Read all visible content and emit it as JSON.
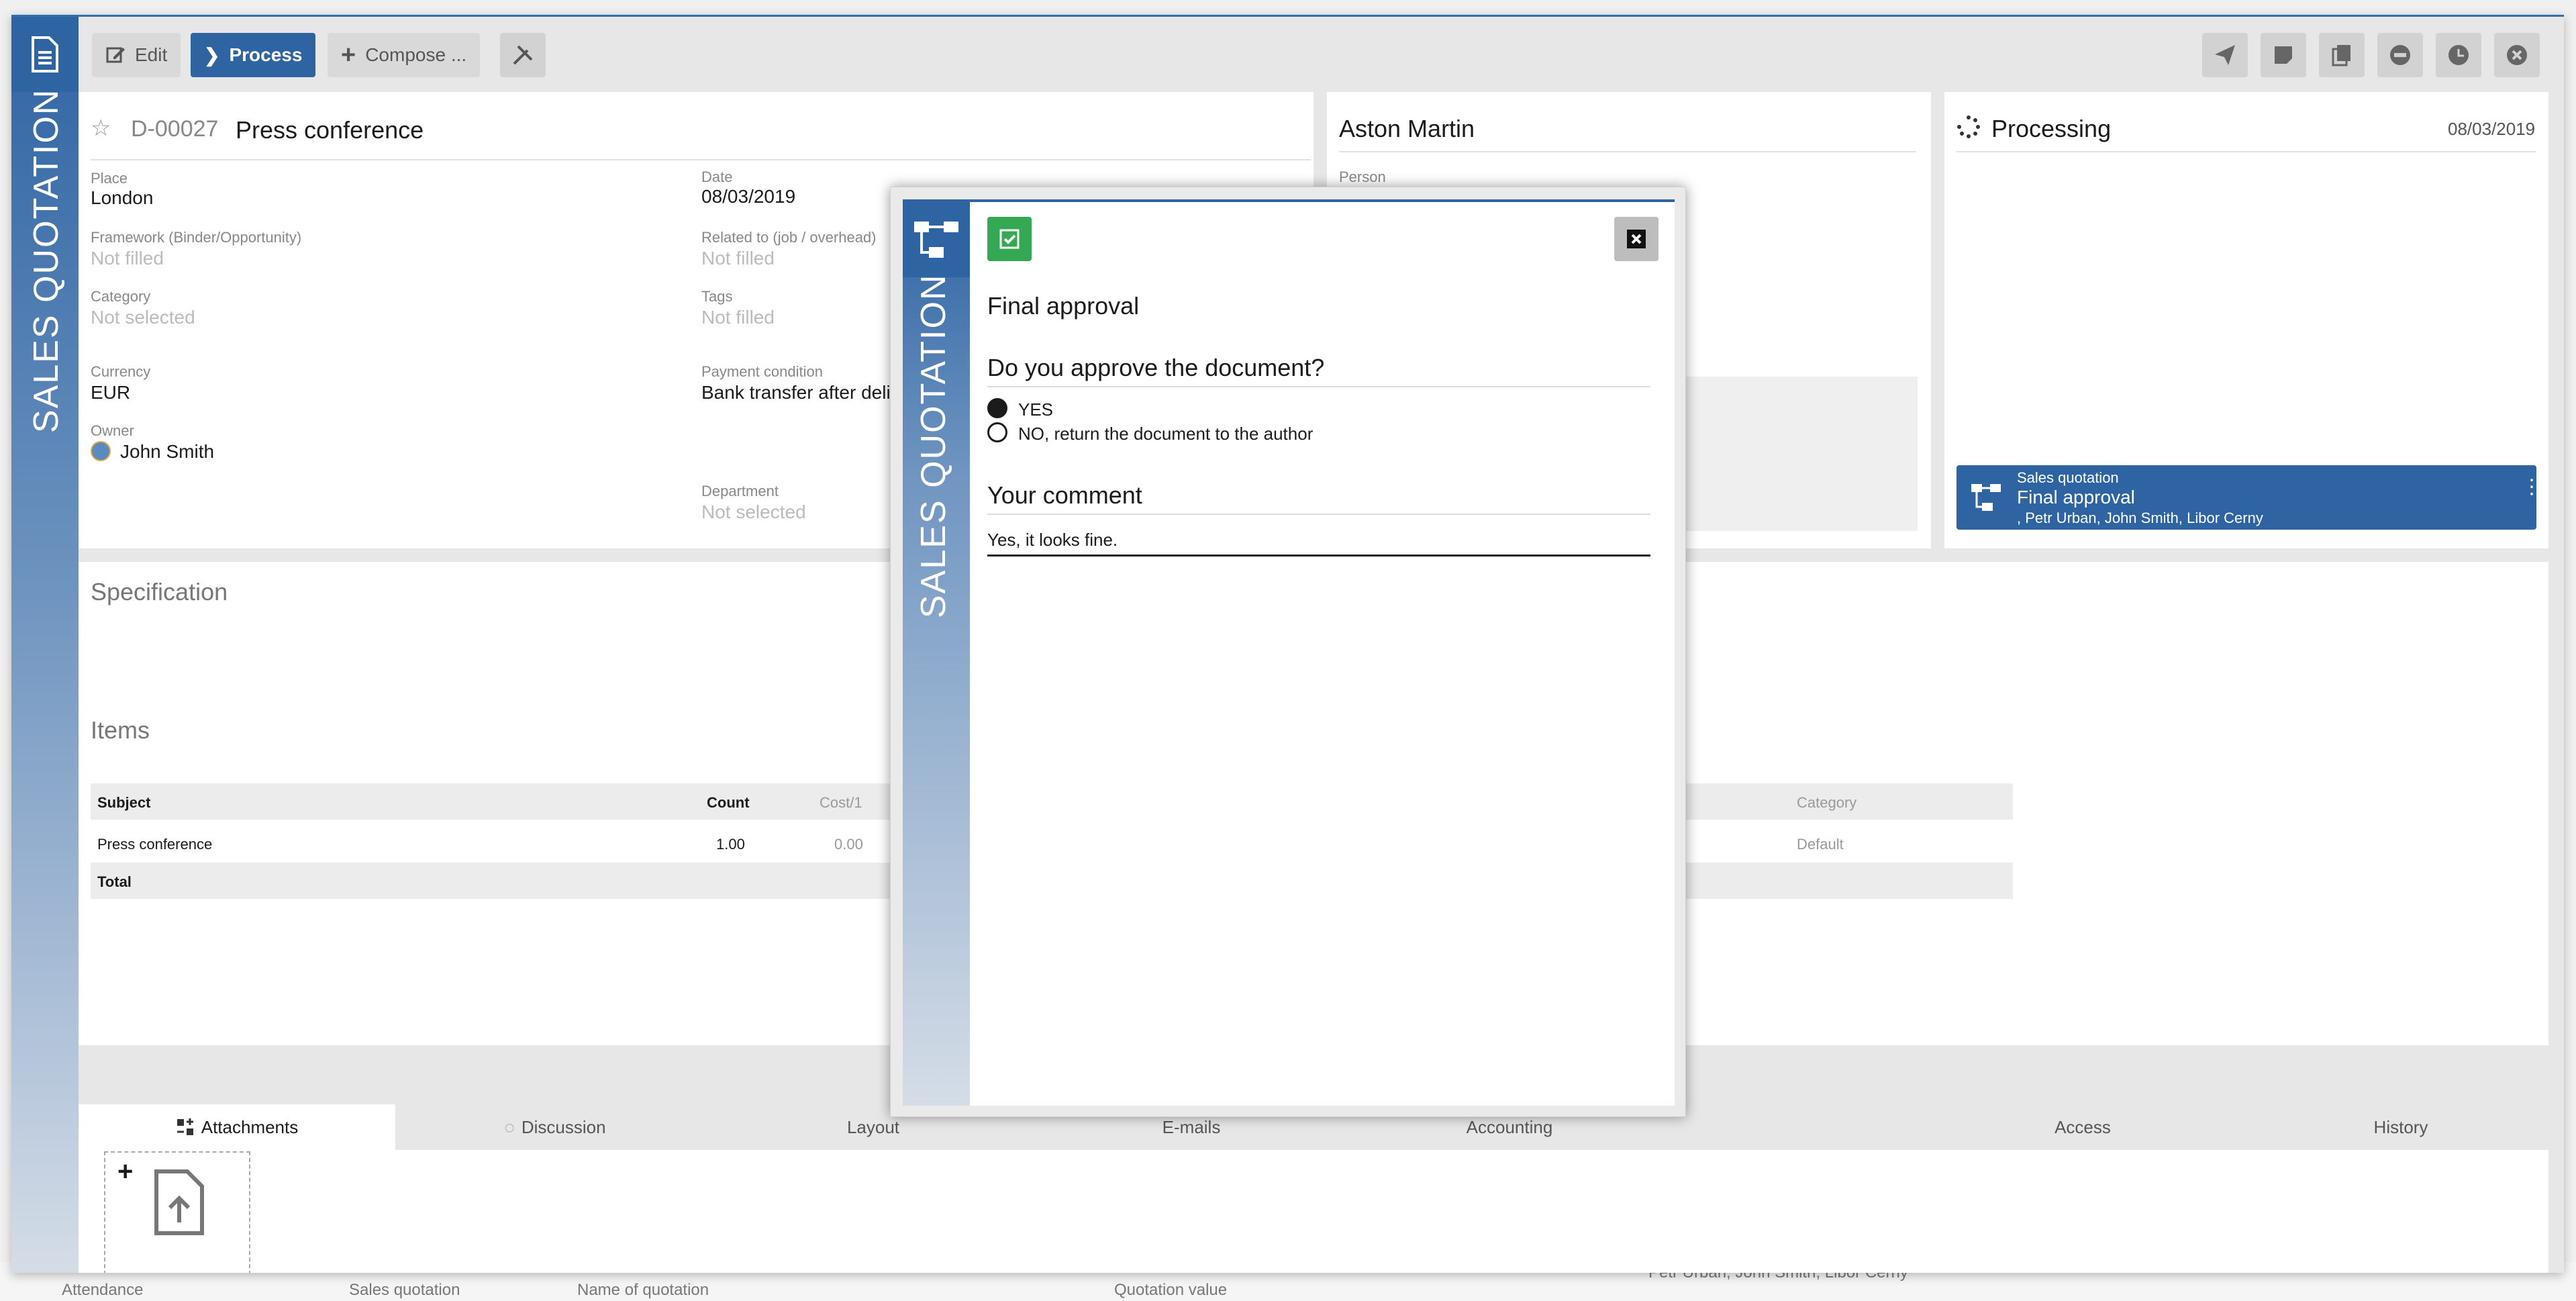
{
  "background": {
    "bottom_items": [
      "Attendance",
      "Sales quotation",
      "Name of quotation",
      "Quotation value",
      "Petr Urban, John Smith, Libor Cerny"
    ]
  },
  "toolbar": {
    "edit_label": "Edit",
    "process_label": "Process",
    "compose_label": "Compose ..."
  },
  "app": {
    "rail_title": "SALES QUOTATION"
  },
  "document": {
    "number": "D-00027",
    "title": "Press conference",
    "fields": {
      "place_label": "Place",
      "place_value": "London",
      "date_label": "Date",
      "date_value": "08/03/2019",
      "framework_label": "Framework (Binder/Opportunity)",
      "framework_value": "Not filled",
      "related_label": "Related to (job / overhead)",
      "related_value": "Not filled",
      "category_label": "Category",
      "category_value": "Not selected",
      "tags_label": "Tags",
      "tags_value": "Not filled",
      "currency_label": "Currency",
      "currency_value": "EUR",
      "payment_label": "Payment condition",
      "payment_value": "Bank transfer after deli",
      "owner_label": "Owner",
      "owner_value": "John Smith",
      "department_label": "Department",
      "department_value": "Not selected"
    }
  },
  "partner": {
    "name": "Aston Martin",
    "person_label": "Person"
  },
  "status": {
    "label": "Processing",
    "date": "08/03/2019",
    "workflow": {
      "kind": "Sales quotation",
      "step": "Final approval",
      "people": ", Petr Urban, John Smith, Libor Cerny"
    }
  },
  "specification": {
    "title": "Specification"
  },
  "items": {
    "title": "Items",
    "columns": {
      "subject": "Subject",
      "count": "Count",
      "cost": "Cost/1",
      "category": "Category"
    },
    "rows": [
      {
        "subject": "Press conference",
        "count": "1.00",
        "cost": "0.00",
        "category": "Default"
      }
    ],
    "total_label": "Total"
  },
  "tabs": [
    "Attachments",
    "Discussion",
    "Layout",
    "E-mails",
    "Accounting",
    "Access",
    "History"
  ],
  "modal": {
    "rail_title": "SALES QUOTATION",
    "heading": "Final approval",
    "question": "Do you approve the document?",
    "option_yes": "YES",
    "option_no": "NO, return the document to the author",
    "comment_label": "Your comment",
    "comment_value": "Yes, it looks fine."
  }
}
